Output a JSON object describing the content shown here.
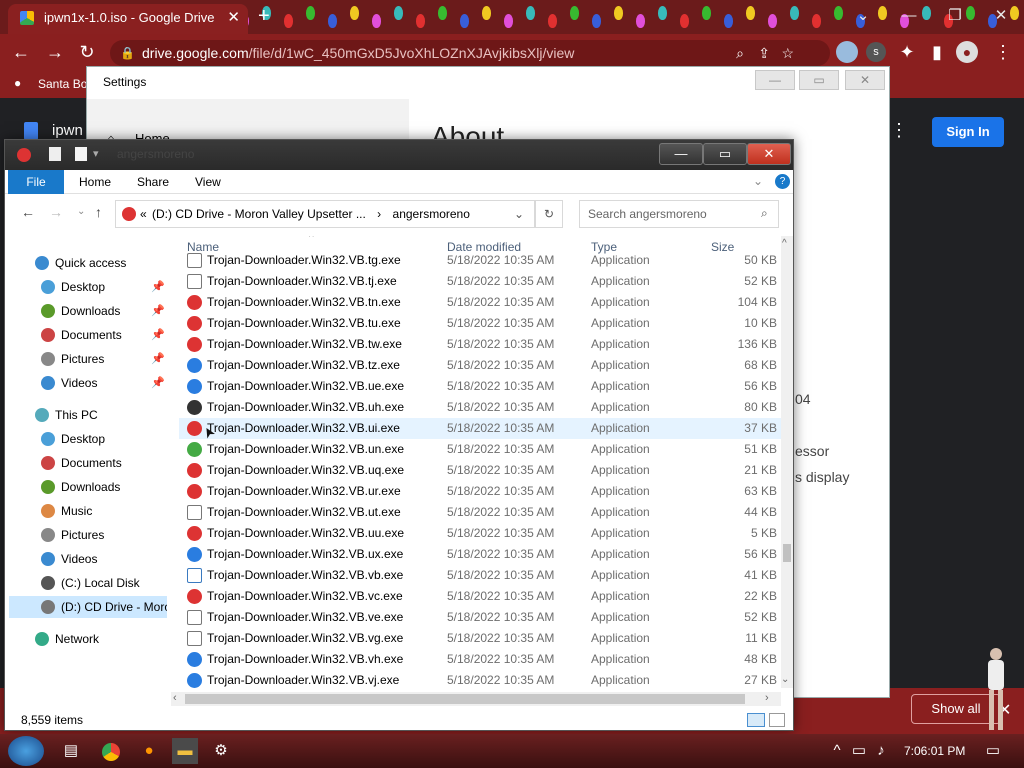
{
  "browser": {
    "tab_title": "ipwn1x-1.0.iso - Google Drive",
    "url_host": "drive.google.com",
    "url_path": "/file/d/1wC_450mGxD5JvoXhLOZnXJAvjkibsXlj/view",
    "bookmark": "Santa Bo",
    "drive_file_label": "ipwn",
    "sign_in": "Sign In",
    "show_all": "Show all"
  },
  "settings": {
    "title": "Settings",
    "nav_home": "Home",
    "heading": "About",
    "frag1": "04",
    "frag2": "essor",
    "frag3": "s display"
  },
  "explorer": {
    "title": "angersmoreno",
    "ribbon_tabs": [
      "File",
      "Home",
      "Share",
      "View"
    ],
    "path_parent": "(D:) CD Drive - Moron Valley Upsetter ...",
    "path_current": "angersmoreno",
    "path_chevron": "«",
    "search_placeholder": "Search angersmoreno",
    "columns": {
      "name": "Name",
      "date": "Date modified",
      "type": "Type",
      "size": "Size"
    },
    "status": "8,559 items",
    "nav": {
      "quick_access": "Quick access",
      "qa_items": [
        "Desktop",
        "Downloads",
        "Documents",
        "Pictures",
        "Videos"
      ],
      "this_pc": "This PC",
      "pc_items": [
        "Desktop",
        "Documents",
        "Downloads",
        "Music",
        "Pictures",
        "Videos",
        "(C:) Local Disk",
        "(D:) CD Drive - Moro"
      ],
      "network": "Network"
    },
    "files": [
      {
        "name": "Trojan-Downloader.Win32.VB.tg.exe",
        "date": "5/18/2022 10:35 AM",
        "type": "Application",
        "size": "50 KB",
        "icon": "app-icon"
      },
      {
        "name": "Trojan-Downloader.Win32.VB.tj.exe",
        "date": "5/18/2022 10:35 AM",
        "type": "Application",
        "size": "52 KB",
        "icon": "app-icon"
      },
      {
        "name": "Trojan-Downloader.Win32.VB.tn.exe",
        "date": "5/18/2022 10:35 AM",
        "type": "Application",
        "size": "104 KB",
        "icon": "red-icon"
      },
      {
        "name": "Trojan-Downloader.Win32.VB.tu.exe",
        "date": "5/18/2022 10:35 AM",
        "type": "Application",
        "size": "10 KB",
        "icon": "red-icon"
      },
      {
        "name": "Trojan-Downloader.Win32.VB.tw.exe",
        "date": "5/18/2022 10:35 AM",
        "type": "Application",
        "size": "136 KB",
        "icon": "red-icon"
      },
      {
        "name": "Trojan-Downloader.Win32.VB.tz.exe",
        "date": "5/18/2022 10:35 AM",
        "type": "Application",
        "size": "68 KB",
        "icon": "ie-icon"
      },
      {
        "name": "Trojan-Downloader.Win32.VB.ue.exe",
        "date": "5/18/2022 10:35 AM",
        "type": "Application",
        "size": "56 KB",
        "icon": "ie-icon"
      },
      {
        "name": "Trojan-Downloader.Win32.VB.uh.exe",
        "date": "5/18/2022 10:35 AM",
        "type": "Application",
        "size": "80 KB",
        "icon": "dark-icon"
      },
      {
        "name": "Trojan-Downloader.Win32.VB.ui.exe",
        "date": "5/18/2022 10:35 AM",
        "type": "Application",
        "size": "37 KB",
        "icon": "red-icon"
      },
      {
        "name": "Trojan-Downloader.Win32.VB.un.exe",
        "date": "5/18/2022 10:35 AM",
        "type": "Application",
        "size": "51 KB",
        "icon": "green-icon"
      },
      {
        "name": "Trojan-Downloader.Win32.VB.uq.exe",
        "date": "5/18/2022 10:35 AM",
        "type": "Application",
        "size": "21 KB",
        "icon": "red-icon"
      },
      {
        "name": "Trojan-Downloader.Win32.VB.ur.exe",
        "date": "5/18/2022 10:35 AM",
        "type": "Application",
        "size": "63 KB",
        "icon": "red-icon"
      },
      {
        "name": "Trojan-Downloader.Win32.VB.ut.exe",
        "date": "5/18/2022 10:35 AM",
        "type": "Application",
        "size": "44 KB",
        "icon": "app-icon"
      },
      {
        "name": "Trojan-Downloader.Win32.VB.uu.exe",
        "date": "5/18/2022 10:35 AM",
        "type": "Application",
        "size": "5 KB",
        "icon": "red-icon"
      },
      {
        "name": "Trojan-Downloader.Win32.VB.ux.exe",
        "date": "5/18/2022 10:35 AM",
        "type": "Application",
        "size": "56 KB",
        "icon": "ie-icon"
      },
      {
        "name": "Trojan-Downloader.Win32.VB.vb.exe",
        "date": "5/18/2022 10:35 AM",
        "type": "Application",
        "size": "41 KB",
        "icon": "window-icon"
      },
      {
        "name": "Trojan-Downloader.Win32.VB.vc.exe",
        "date": "5/18/2022 10:35 AM",
        "type": "Application",
        "size": "22 KB",
        "icon": "red-icon"
      },
      {
        "name": "Trojan-Downloader.Win32.VB.ve.exe",
        "date": "5/18/2022 10:35 AM",
        "type": "Application",
        "size": "52 KB",
        "icon": "app-icon"
      },
      {
        "name": "Trojan-Downloader.Win32.VB.vg.exe",
        "date": "5/18/2022 10:35 AM",
        "type": "Application",
        "size": "11 KB",
        "icon": "app-icon"
      },
      {
        "name": "Trojan-Downloader.Win32.VB.vh.exe",
        "date": "5/18/2022 10:35 AM",
        "type": "Application",
        "size": "48 KB",
        "icon": "ie-icon"
      },
      {
        "name": "Trojan-Downloader.Win32.VB.vj.exe",
        "date": "5/18/2022 10:35 AM",
        "type": "Application",
        "size": "27 KB",
        "icon": "ie-icon"
      }
    ]
  },
  "taskbar": {
    "clock": "7:06:01 PM"
  },
  "colors": {
    "accent": "#1979ca",
    "chrome_red": "#8a1f1f",
    "selection": "#e5f3ff",
    "signin": "#1a73e8"
  }
}
